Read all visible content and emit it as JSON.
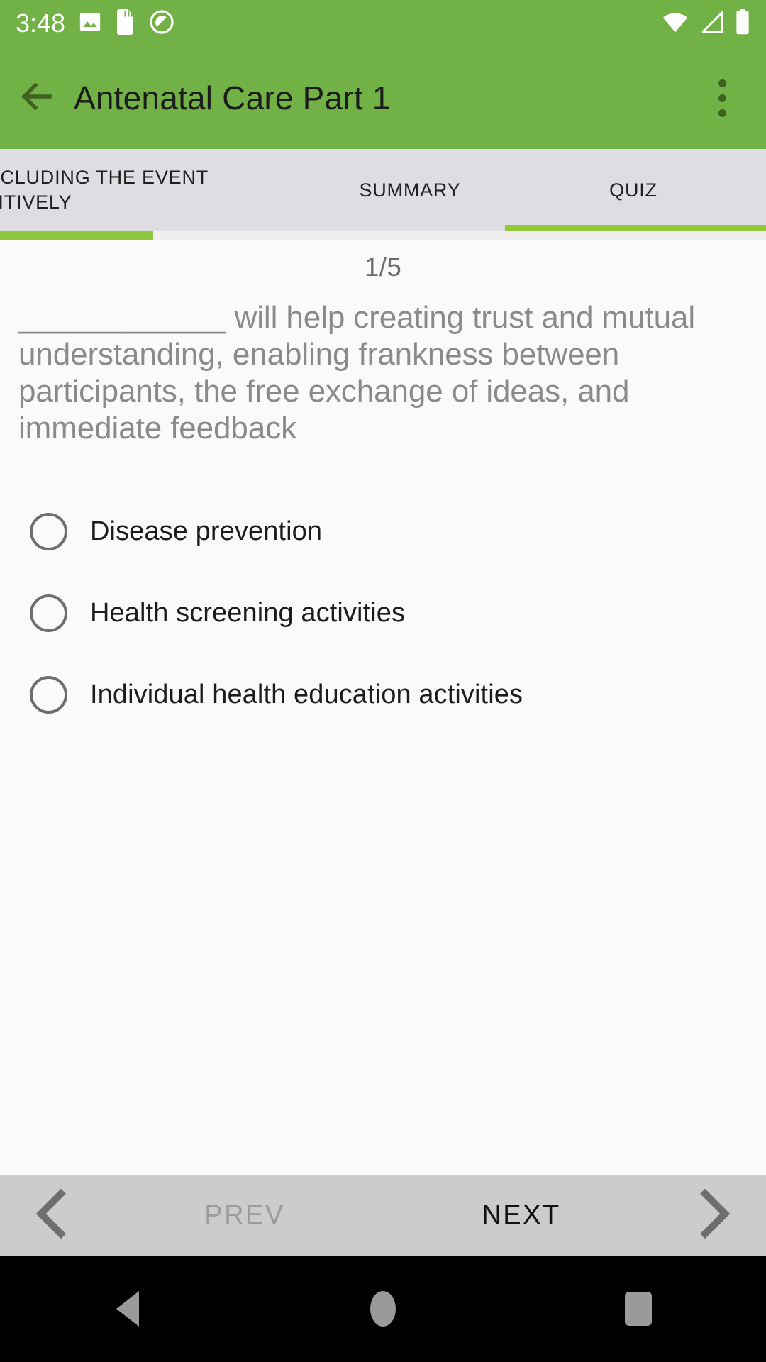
{
  "status_bar": {
    "time": "3:48",
    "left_icons": [
      "image-icon",
      "sd-card-icon",
      "do-not-disturb-icon"
    ],
    "right_icons": [
      "wifi-icon",
      "cellular-signal-icon",
      "battery-icon"
    ],
    "background_color": "#72B145"
  },
  "app_bar": {
    "back_label": "back-arrow-icon",
    "title": "Antenatal Care Part 1",
    "overflow_label": "more-options-icon",
    "background_color": "#72B145"
  },
  "tabs": {
    "items": [
      {
        "label": "CONCLUDING THE EVENT POSITIVELY",
        "selected": false
      },
      {
        "label": "SUMMARY",
        "selected": false
      },
      {
        "label": "QUIZ",
        "selected": true
      }
    ],
    "indicator_color": "#95C93D",
    "background_color": "#DEDDE1"
  },
  "progress": {
    "percent": 20,
    "fill_color": "#8CC63E",
    "track_color": "#EFEFEF"
  },
  "quiz": {
    "counter": "1/5",
    "current": 1,
    "total": 5,
    "question": "____________  will help creating trust and mutual understanding, enabling frankness between participants, the free exchange of ideas, and immediate feedback",
    "options": [
      {
        "label": "Disease prevention",
        "selected": false
      },
      {
        "label": "Health screening activities",
        "selected": false
      },
      {
        "label": "Individual health education activities",
        "selected": false
      }
    ]
  },
  "quiz_nav": {
    "prev_label": "PREV",
    "prev_enabled": false,
    "next_label": "NEXT",
    "next_enabled": true,
    "prev_icon": "chevron-left-icon",
    "next_icon": "chevron-right-icon",
    "background_color": "#CCCCCC"
  },
  "system_nav": {
    "back": "back-triangle-icon",
    "home": "home-circle-icon",
    "recents": "recents-square-icon"
  }
}
